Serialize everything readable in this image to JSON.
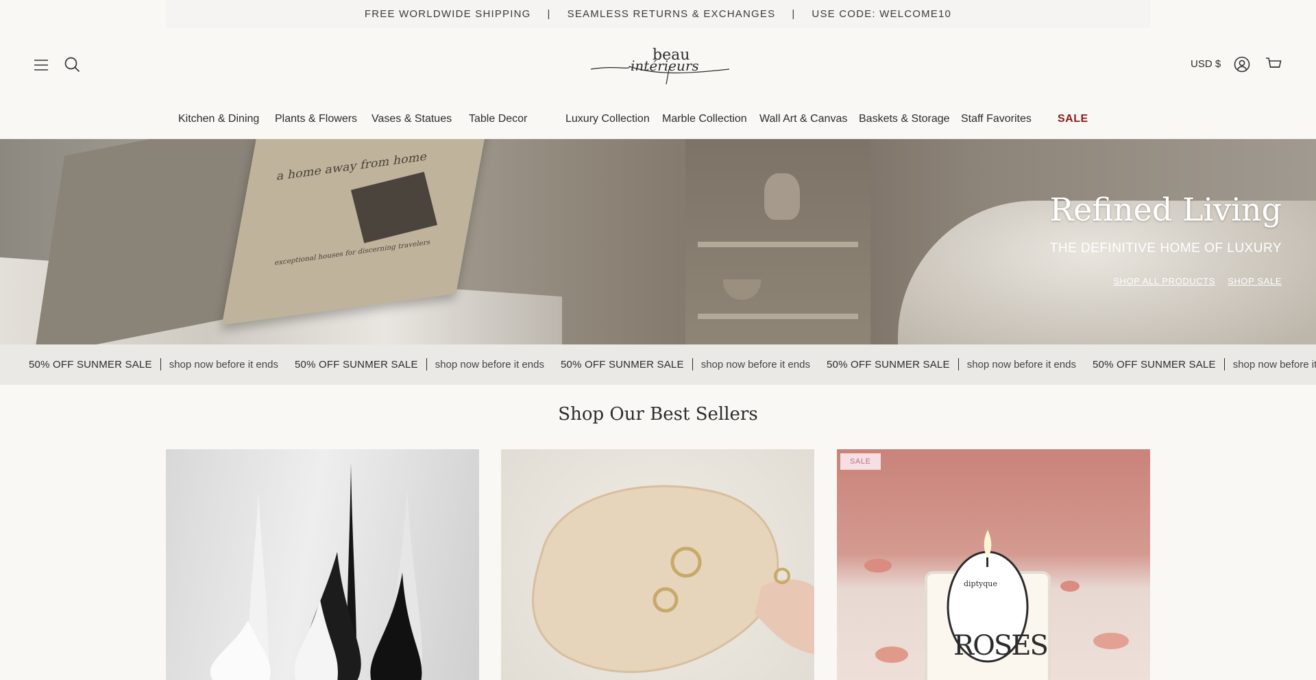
{
  "announcement": {
    "items": [
      "FREE WORLDWIDE SHIPPING",
      "SEAMLESS RETURNS & EXCHANGES",
      "USE CODE: WELCOME10"
    ],
    "separator": "|"
  },
  "header": {
    "logo_text": "beau",
    "logo_script": "intérieurs",
    "currency": "USD $",
    "icons": [
      "menu-icon",
      "search-icon",
      "account-icon",
      "cart-icon"
    ]
  },
  "nav": {
    "items": [
      "Kitchen & Dining",
      "Plants & Flowers",
      "Vases & Statues",
      "Table Decor",
      "Luxury Collection",
      "Marble Collection",
      "Wall Art & Canvas",
      "Baskets & Storage",
      "Staff Favorites",
      "SALE"
    ],
    "sale_color": "#8b1a1a"
  },
  "hero": {
    "title": "Refined Living",
    "subtitle": "THE DEFINITIVE HOME OF LUXURY",
    "link_all": "SHOP ALL PRODUCTS",
    "link_sale": "SHOP SALE",
    "book_title": "a home away from home",
    "book_subtitle": "exceptional houses for discerning travelers"
  },
  "marquee": {
    "strong": "50% OFF SUNMER SALE",
    "light": "shop now before it ends",
    "last_light": "shop now before it en"
  },
  "best_sellers": {
    "title": "Shop Our Best Sellers",
    "badge": "SALE",
    "candle_brand": "diptyque",
    "candle_label": "ROSES"
  }
}
